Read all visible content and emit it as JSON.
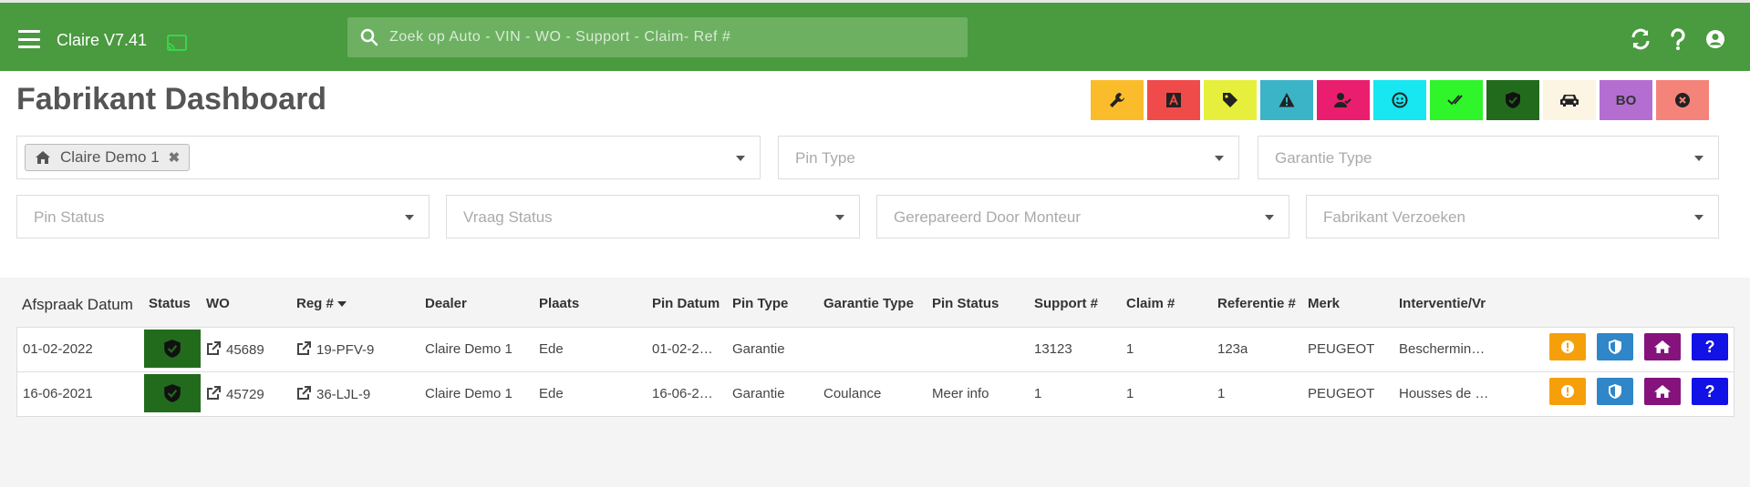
{
  "header": {
    "app_title": "Claire V7.41",
    "search_placeholder": "Zoek op Auto - VIN - WO - Support - Claim- Ref #"
  },
  "page": {
    "title": "Fabrikant Dashboard"
  },
  "quick_buttons": [
    {
      "icon": "wrench-icon",
      "color": "#fbbc2c"
    },
    {
      "icon": "letter-a-icon",
      "color": "#f04b4b"
    },
    {
      "icon": "tag-icon",
      "color": "#e6f03c"
    },
    {
      "icon": "warning-icon",
      "color": "#3cb4c8"
    },
    {
      "icon": "user-check-icon",
      "color": "#ea1e6e"
    },
    {
      "icon": "smiley-icon",
      "color": "#18e6f0"
    },
    {
      "icon": "double-check-icon",
      "color": "#2ff52a"
    },
    {
      "icon": "shield-check-icon",
      "color": "#236b1c"
    },
    {
      "icon": "car-icon",
      "color": "#fdf5e4"
    },
    {
      "label": "BO",
      "color": "#b46ed2"
    },
    {
      "icon": "close-circle-icon",
      "color": "#f4847a"
    }
  ],
  "filters": {
    "dealer_chip": "Claire Demo 1",
    "pin_type": "Pin Type",
    "garantie_type": "Garantie Type",
    "pin_status": "Pin Status",
    "vraag_status": "Vraag Status",
    "gerepareerd": "Gerepareerd Door Monteur",
    "fabrikant_verzoeken": "Fabrikant Verzoeken"
  },
  "table": {
    "headers": {
      "afspraak_datum": "Afspraak Datum",
      "status": "Status",
      "wo": "WO",
      "reg": "Reg #",
      "dealer": "Dealer",
      "plaats": "Plaats",
      "pin_datum": "Pin Datum",
      "pin_type": "Pin Type",
      "garantie_type": "Garantie Type",
      "pin_status": "Pin Status",
      "support": "Support #",
      "claim": "Claim #",
      "referentie": "Referentie #",
      "merk": "Merk",
      "interventie": "Interventie/Vr"
    },
    "rows": [
      {
        "afspraak_datum": "01-02-2022",
        "wo": "45689",
        "reg": "19-PFV-9",
        "dealer": "Claire Demo 1",
        "plaats": "Ede",
        "pin_datum": "01-02-2…",
        "pin_type": "Garantie",
        "garantie_type": "",
        "pin_status": "",
        "support": "13123",
        "claim": "1",
        "referentie": "123a",
        "merk": "PEUGEOT",
        "interventie": "Beschermin…"
      },
      {
        "afspraak_datum": "16-06-2021",
        "wo": "45729",
        "reg": "36-LJL-9",
        "dealer": "Claire Demo 1",
        "plaats": "Ede",
        "pin_datum": "16-06-2…",
        "pin_type": "Garantie",
        "garantie_type": "Coulance",
        "pin_status": "Meer info",
        "support": "1",
        "claim": "1",
        "referentie": "1",
        "merk": "PEUGEOT",
        "interventie": "Housses de …"
      }
    ],
    "row_actions": [
      {
        "icon": "exclamation-icon",
        "color": "#f5a00a"
      },
      {
        "icon": "shield-icon",
        "color": "#2f86c8"
      },
      {
        "icon": "home-icon",
        "color": "#86127c"
      },
      {
        "label": "?",
        "color": "#1212e6"
      }
    ]
  }
}
